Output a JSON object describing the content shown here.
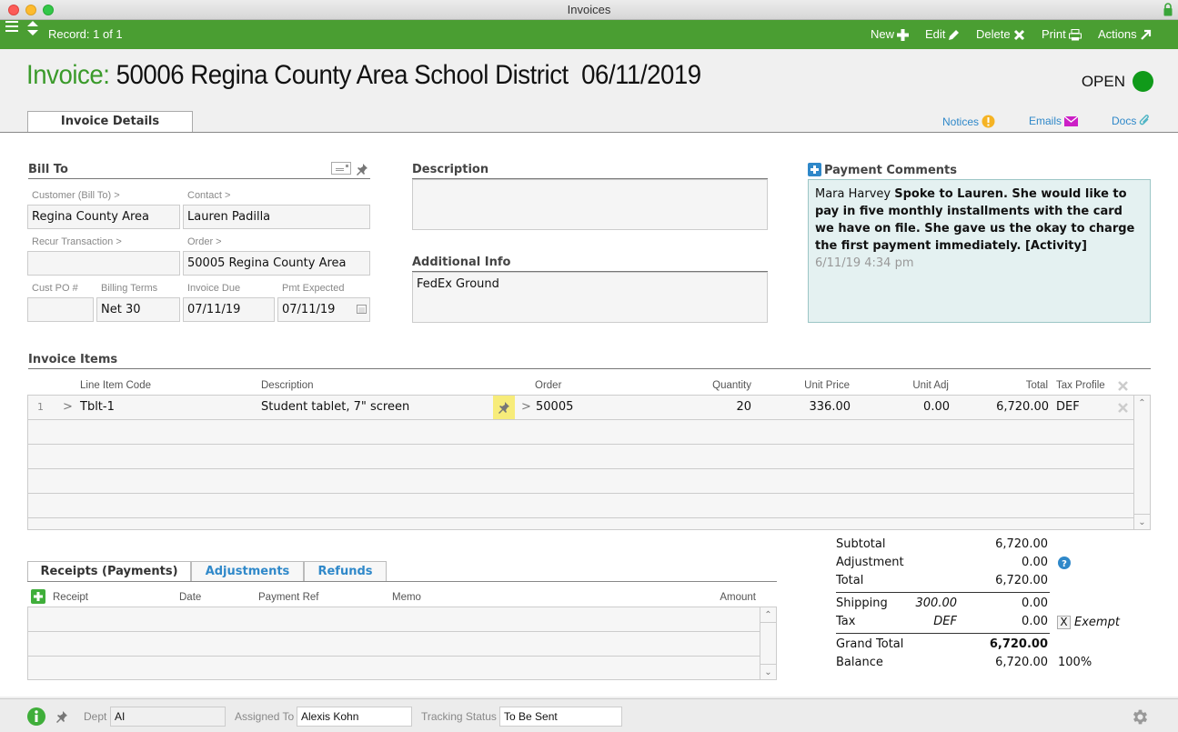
{
  "window": {
    "title": "Invoices"
  },
  "toolbar": {
    "record": "Record: 1 of 1",
    "new": "New",
    "edit": "Edit",
    "delete": "Delete",
    "print": "Print",
    "actions": "Actions"
  },
  "header": {
    "label": "Invoice:",
    "title": "50006 Regina County Area School District  06/11/2019",
    "status": "OPEN",
    "status_color": "#109a1a"
  },
  "tabs": {
    "details": "Invoice Details"
  },
  "links": {
    "notices": "Notices",
    "emails": "Emails",
    "docs": "Docs"
  },
  "bill_to": {
    "heading": "Bill To",
    "customer_label": "Customer (Bill To) >",
    "customer": "Regina County Area",
    "contact_label": "Contact >",
    "contact": "Lauren Padilla",
    "recur_label": "Recur Transaction >",
    "recur": "",
    "order_label": "Order >",
    "order": "50005 Regina County Area",
    "po_label": "Cust PO #",
    "po": "",
    "terms_label": "Billing Terms",
    "terms": "Net 30",
    "due_label": "Invoice Due",
    "due": "07/11/19",
    "expected_label": "Pmt Expected",
    "expected": "07/11/19"
  },
  "description": {
    "heading": "Description",
    "value": ""
  },
  "additional": {
    "heading": "Additional Info",
    "value": "FedEx Ground"
  },
  "comments": {
    "heading": "Payment Comments",
    "author": "Mara Harvey",
    "text": "Spoke to Lauren. She would like to pay in five monthly installments with the card we have on file. She gave us the okay to charge the first payment immediately. [Activity]",
    "timestamp": "6/11/19  4:34 pm"
  },
  "items": {
    "heading": "Invoice Items",
    "columns": {
      "code": "Line Item Code",
      "description": "Description",
      "order": "Order",
      "quantity": "Quantity",
      "unit_price": "Unit Price",
      "unit_adj": "Unit Adj",
      "total": "Total",
      "tax": "Tax Profile"
    },
    "rows": [
      {
        "num": "1",
        "code": "Tblt-1",
        "description": "Student tablet, 7\" screen",
        "order": "50005",
        "quantity": "20",
        "unit_price": "336.00",
        "unit_adj": "0.00",
        "total": "6,720.00",
        "tax": "DEF"
      }
    ]
  },
  "payments": {
    "tabs": [
      "Receipts (Payments)",
      "Adjustments",
      "Refunds"
    ],
    "columns": {
      "receipt": "Receipt",
      "date": "Date",
      "ref": "Payment Ref",
      "memo": "Memo",
      "amount": "Amount"
    }
  },
  "summary": {
    "subtotal_label": "Subtotal",
    "subtotal": "6,720.00",
    "adjustment_label": "Adjustment",
    "adjustment": "0.00",
    "total_label": "Total",
    "total": "6,720.00",
    "shipping_label": "Shipping",
    "shipping_base": "300.00",
    "shipping": "0.00",
    "tax_label": "Tax",
    "tax_profile": "DEF",
    "tax": "0.00",
    "exempt_label": "Exempt",
    "exempt_checked": "X",
    "grand_total_label": "Grand Total",
    "grand_total": "6,720.00",
    "balance_label": "Balance",
    "balance": "6,720.00",
    "balance_pct": "100%"
  },
  "footer": {
    "dept_label": "Dept",
    "dept": "AI",
    "assigned_label": "Assigned To",
    "assigned": "Alexis Kohn",
    "tracking_label": "Tracking Status",
    "tracking": "To Be Sent"
  }
}
